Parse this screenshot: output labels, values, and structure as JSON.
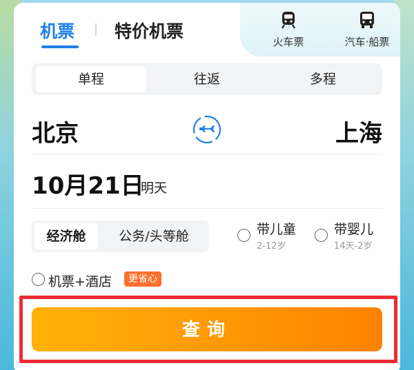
{
  "header": {
    "tabs": [
      {
        "label": "机票",
        "active": true
      },
      {
        "label": "特价机票",
        "active": false
      }
    ],
    "other_modes": [
      {
        "label": "火车票",
        "icon": "train-icon"
      },
      {
        "label": "汽车·船票",
        "icon": "bus-icon"
      }
    ]
  },
  "trip_type": {
    "options": [
      "单程",
      "往返",
      "多程"
    ],
    "selected": "单程"
  },
  "route": {
    "from": "北京",
    "to": "上海",
    "swap_icon": "plane-swap-icon"
  },
  "date": {
    "value": "10月21日",
    "hint": "明天"
  },
  "cabin": {
    "options": [
      "经济舱",
      "公务/头等舱"
    ],
    "selected": "经济舱"
  },
  "passengers": {
    "child": {
      "label": "带儿童",
      "sub": "2-12岁"
    },
    "infant": {
      "label": "带婴儿",
      "sub": "14天-2岁"
    }
  },
  "combo": {
    "label": "机票+酒店",
    "badge": "更省心"
  },
  "search": {
    "label": "查询"
  },
  "colors": {
    "primary_blue": "#1f80e6",
    "search_orange_start": "#ffb20a",
    "search_orange_end": "#ff8200",
    "badge_orange": "#ff6e2b",
    "highlight_red": "#ee2b34"
  }
}
